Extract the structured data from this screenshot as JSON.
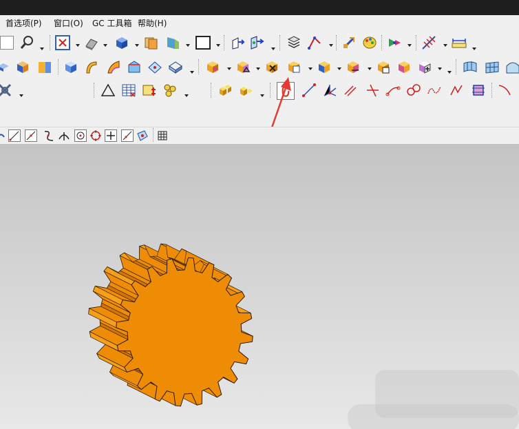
{
  "menu": {
    "items": [
      {
        "label": "首选项(P)"
      },
      {
        "label": "窗口(O)"
      },
      {
        "label": "GC 工具箱"
      },
      {
        "label": "帮助(H)"
      }
    ]
  },
  "colors": {
    "gear_fill": "#ef8c05",
    "gear_shadow": "#c96e00",
    "gear_outline": "#2a1a00",
    "annotation_arrow": "#e53935",
    "titlebar": "#1e1e1e",
    "toolbar_bg": "#f0f0f0"
  },
  "toolbars": {
    "row1_icons": [
      "zoom-icon",
      "fit-view-icon",
      "shade-mode-icon",
      "solid-box-icon",
      "layer-icon",
      "view-orient-icon",
      "background-icon",
      "sketch-plane-icon",
      "datum-csys-icon",
      "table-of-layers-icon",
      "curve-tool-icon",
      "move-object-icon",
      "paint-icon",
      "snap-view-icon",
      "measure-distance-icon",
      "ruler-icon"
    ],
    "row2_icons": [
      "extrude-icon",
      "revolve-icon",
      "blend-icon",
      "block-icon",
      "chamfer-icon",
      "shell-icon",
      "draft-icon",
      "face-icon",
      "unite-icon",
      "subtract-icon",
      "trim-body-icon",
      "offset-face-icon",
      "pattern-icon",
      "mirror-icon",
      "thicken-icon",
      "replace-face-icon",
      "feature-table-icon",
      "surface-icon",
      "mesh-surface-icon",
      "swept-icon"
    ],
    "row3_icons": [
      "assembly-icon",
      "triangle-icon",
      "spreadsheet-icon",
      "grid-add-icon",
      "components-icon",
      "gear-box-icon",
      "gear-box-alt-icon",
      "select-icon",
      "line-icon",
      "axis-icon",
      "parallel-line-icon",
      "cross-line-icon",
      "arc-icon",
      "circle-chain-icon",
      "spline-icon",
      "curve-icon",
      "trim-curve-icon",
      "rect-icon",
      "angle-icon"
    ]
  },
  "selection_bar": {
    "icons": [
      "point-snap-icon",
      "endpoint-icon",
      "curve-point-icon",
      "intersection-icon",
      "center-icon",
      "quadrant-icon",
      "existing-point-icon",
      "midpoint-icon",
      "face-point-icon",
      "grid-icon"
    ]
  }
}
